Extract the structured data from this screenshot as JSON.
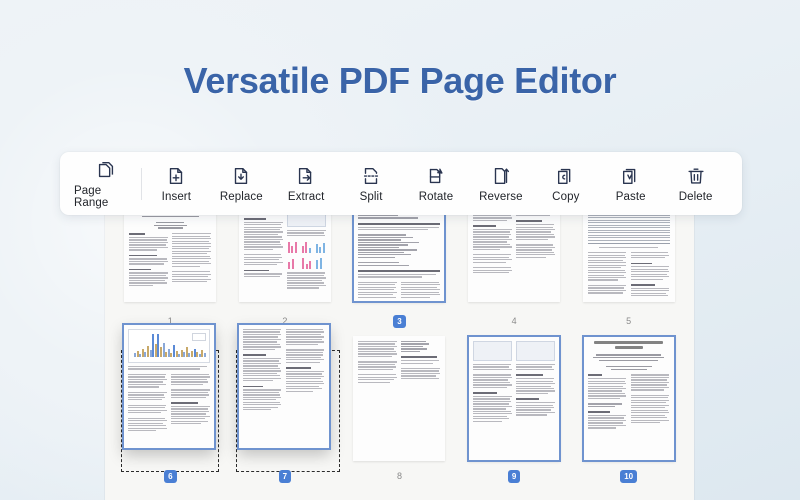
{
  "title": "Versatile PDF Page Editor",
  "toolbar": {
    "items": [
      {
        "label": "Page Range",
        "icon": "stacked-pages-icon"
      },
      {
        "label": "Insert",
        "icon": "page-plus-icon"
      },
      {
        "label": "Replace",
        "icon": "page-replace-icon"
      },
      {
        "label": "Extract",
        "icon": "page-arrow-right-icon"
      },
      {
        "label": "Split",
        "icon": "page-dashed-split-icon"
      },
      {
        "label": "Rotate",
        "icon": "page-rotate-icon"
      },
      {
        "label": "Reverse",
        "icon": "page-reverse-icon"
      },
      {
        "label": "Copy",
        "icon": "page-copy-c-icon"
      },
      {
        "label": "Paste",
        "icon": "page-paste-v-icon"
      },
      {
        "label": "Delete",
        "icon": "trash-icon"
      }
    ]
  },
  "pages": [
    {
      "number": "1",
      "selected": false,
      "dragging": false,
      "kind": "title-page"
    },
    {
      "number": "2",
      "selected": false,
      "dragging": false,
      "kind": "figures-color"
    },
    {
      "number": "3",
      "selected": true,
      "dragging": false,
      "kind": "code-listing"
    },
    {
      "number": "4",
      "selected": false,
      "dragging": false,
      "kind": "text"
    },
    {
      "number": "5",
      "selected": false,
      "dragging": false,
      "kind": "table"
    },
    {
      "number": "6",
      "selected": true,
      "dragging": true,
      "kind": "bar-chart"
    },
    {
      "number": "7",
      "selected": true,
      "dragging": true,
      "kind": "text"
    },
    {
      "number": "8",
      "selected": false,
      "dragging": false,
      "kind": "text"
    },
    {
      "number": "9",
      "selected": true,
      "dragging": false,
      "kind": "diagram"
    },
    {
      "number": "10",
      "selected": true,
      "dragging": false,
      "kind": "title-page"
    }
  ],
  "colors": {
    "title": "#3a64a8",
    "accent": "#4a7fd4",
    "selection_border": "#6f93cf",
    "panel_bg": "#f7f7f5",
    "toolbar_bg": "#fefefe"
  },
  "page10_doc_title": "Trace-based Just-in-Time Type Specialization for Dynamic Languages"
}
